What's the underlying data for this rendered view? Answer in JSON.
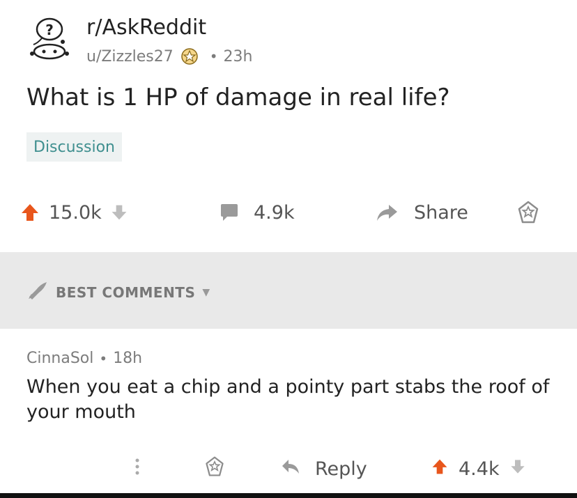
{
  "post": {
    "subreddit": "r/AskReddit",
    "author": "u/Zizzles27",
    "time": "23h",
    "title": "What is 1 HP of damage in real life?",
    "flair": "Discussion",
    "upvotes": "15.0k",
    "comments": "4.9k",
    "share_label": "Share"
  },
  "sort": {
    "label": "BEST COMMENTS"
  },
  "comment": {
    "author": "CinnaSol",
    "time": "18h",
    "body": "When you eat a chip and a pointy part stabs the roof of your mouth",
    "reply_label": "Reply",
    "upvotes": "4.4k"
  },
  "colors": {
    "upvote": "#e8561c",
    "flair_text": "#3f8f8f",
    "muted": "#7c7c7c"
  },
  "icons": [
    "askreddit-snoo-icon",
    "award-icon",
    "upvote-icon",
    "downvote-icon",
    "comment-icon",
    "share-icon",
    "save-icon",
    "rocket-icon",
    "more-icon",
    "reply-icon"
  ]
}
